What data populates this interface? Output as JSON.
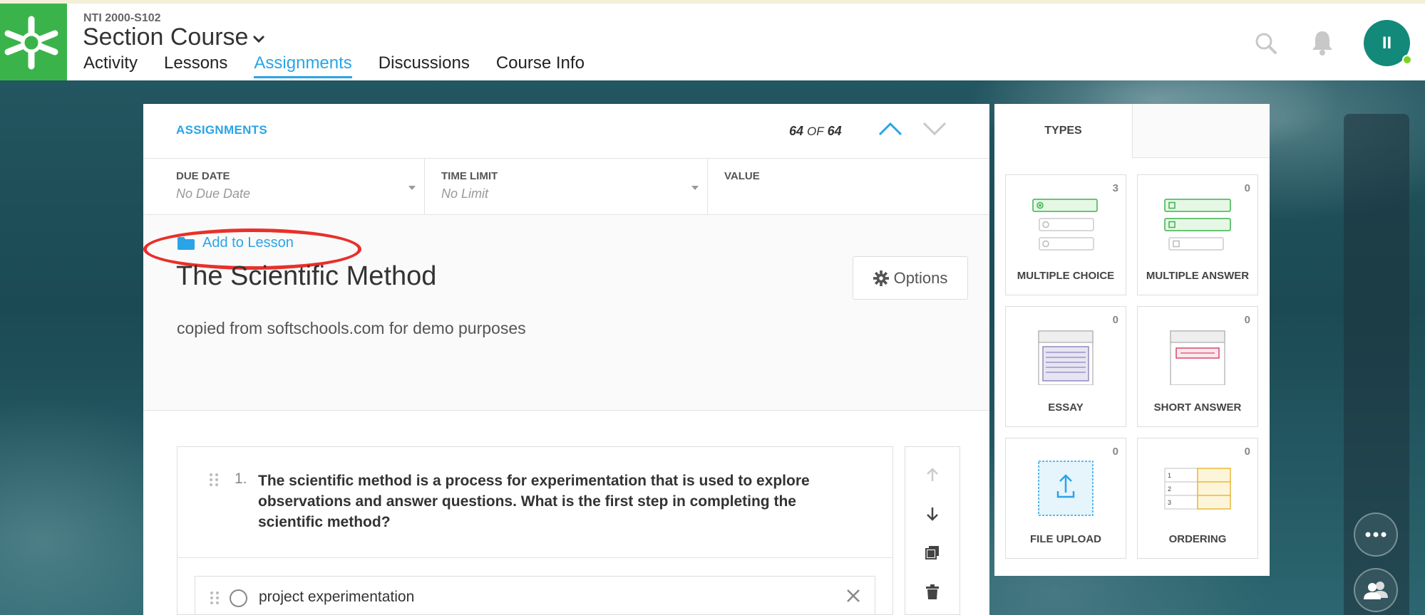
{
  "header": {
    "course_code": "NTI 2000-S102",
    "course_title": "Section Course",
    "nav": [
      "Activity",
      "Lessons",
      "Assignments",
      "Discussions",
      "Course Info"
    ],
    "active_nav": "Assignments",
    "avatar_initials": "II"
  },
  "panel": {
    "section_label": "ASSIGNMENTS",
    "count_current": "64",
    "count_of": "OF",
    "count_total": "64",
    "fields": [
      {
        "label": "DUE DATE",
        "value": "No Due Date"
      },
      {
        "label": "TIME LIMIT",
        "value": "No Limit"
      },
      {
        "label": "VALUE",
        "value": ""
      }
    ],
    "add_to_lesson": "Add to Lesson",
    "title": "The Scientific Method",
    "options_label": "Options",
    "description": "copied from softschools.com for demo purposes"
  },
  "question": {
    "number": "1.",
    "text": "The scientific method is a process for experimentation that is used to explore observations and answer questions. What is the first step in completing the scientific method?",
    "answers": [
      "project experimentation"
    ]
  },
  "types": {
    "tab_label": "TYPES",
    "items": [
      {
        "label": "MULTIPLE CHOICE",
        "count": "3"
      },
      {
        "label": "MULTIPLE ANSWER",
        "count": "0"
      },
      {
        "label": "ESSAY",
        "count": "0"
      },
      {
        "label": "SHORT ANSWER",
        "count": "0"
      },
      {
        "label": "FILE UPLOAD",
        "count": "0"
      },
      {
        "label": "ORDERING",
        "count": "0"
      }
    ]
  },
  "colors": {
    "brand_green": "#3ab44a",
    "accent_blue": "#2aa4e6",
    "avatar_teal": "#13897a",
    "highlight_red": "#e8302a"
  }
}
